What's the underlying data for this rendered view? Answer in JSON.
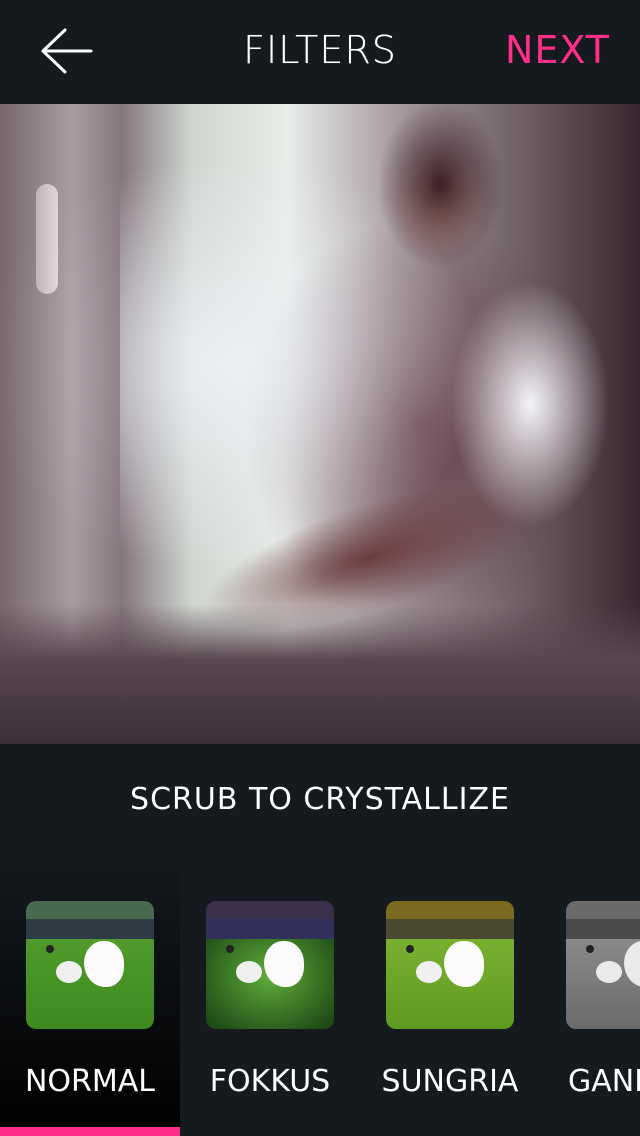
{
  "header": {
    "title": "FILTERS",
    "next_label": "NEXT",
    "back_icon": "arrow-left-icon"
  },
  "caption": "SCRUB TO CRYSTALLIZE",
  "filters": [
    {
      "label": "NORMAL",
      "selected": true
    },
    {
      "label": "FOKKUS",
      "selected": false
    },
    {
      "label": "SUNGRIA",
      "selected": false
    },
    {
      "label": "GANDALF",
      "selected": false
    }
  ],
  "colors": {
    "accent": "#ff2e8a",
    "background": "#151a1f"
  }
}
